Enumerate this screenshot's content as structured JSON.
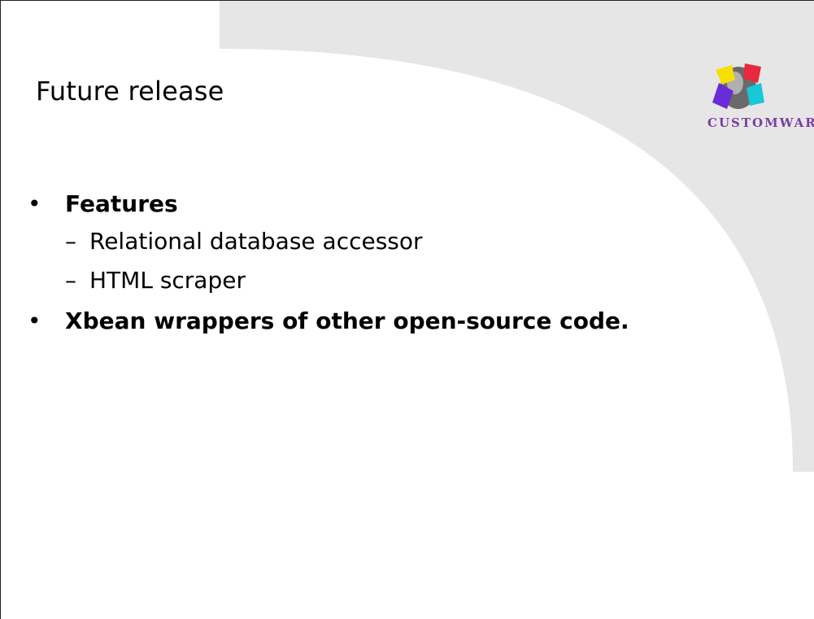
{
  "slide": {
    "title": "Future release",
    "logo": {
      "icon": "customware-logo-icon",
      "text": "CUSTOMWARE"
    },
    "bullets": [
      {
        "marker": "•",
        "text": "Features",
        "children": [
          {
            "marker": "–",
            "text": "Relational database accessor"
          },
          {
            "marker": "–",
            "text": "HTML scraper"
          }
        ]
      },
      {
        "marker": "•",
        "text": "Xbean wrappers of other open-source code.",
        "children": []
      }
    ]
  },
  "colors": {
    "background": "#ffffff",
    "swoosh": "#e6e6e6",
    "text": "#000000",
    "logo_text": "#7a3fa0"
  }
}
